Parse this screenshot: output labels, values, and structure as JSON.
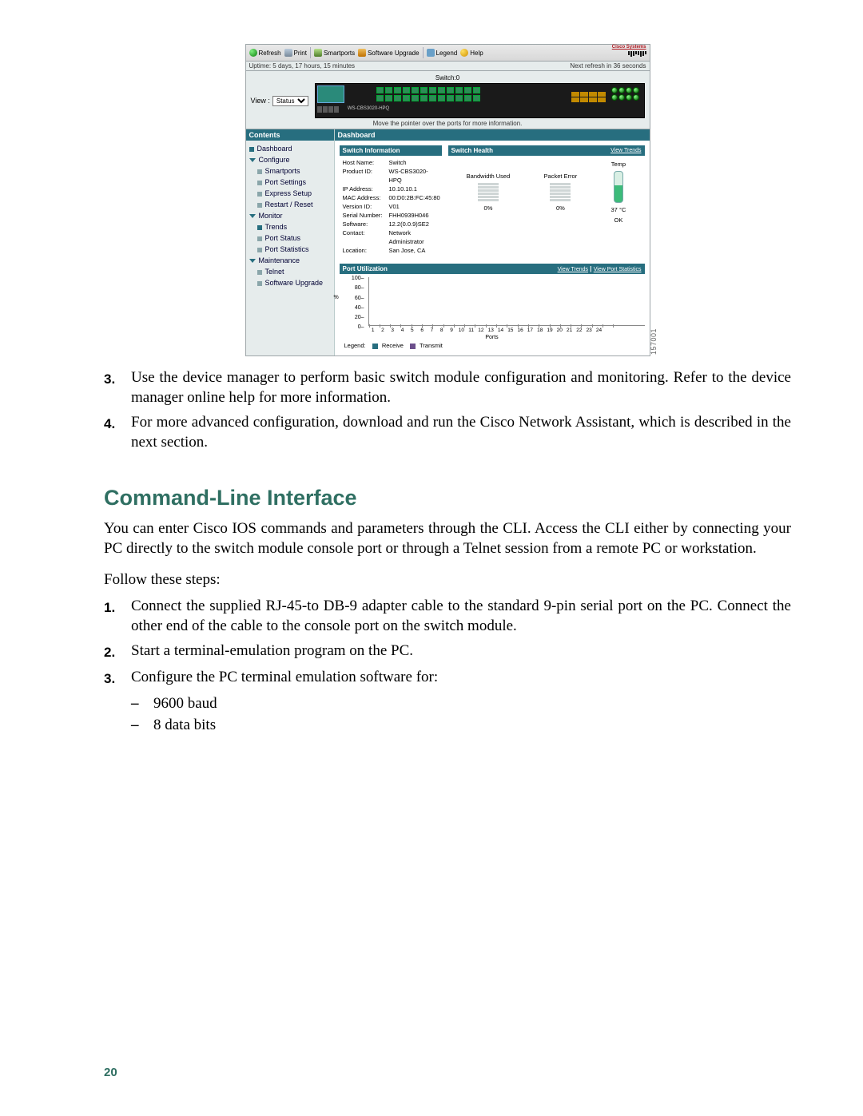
{
  "screenshot": {
    "toolbar": {
      "refresh": "Refresh",
      "print": "Print",
      "smartports": "Smartports",
      "software_upgrade": "Software Upgrade",
      "legend": "Legend",
      "help": "Help",
      "brand": "Cisco Systems"
    },
    "status_bar": {
      "uptime": "Uptime: 5 days, 17 hours, 15 minutes",
      "next_refresh": "Next refresh in 36 seconds"
    },
    "device": {
      "switch_label": "Switch:0",
      "view_label": "View :",
      "view_options": [
        "Status"
      ],
      "model_label": "WS-CBS3020-HPQ",
      "pointer_hint": "Move the pointer over the ports for more information."
    },
    "nav": {
      "header": "Contents",
      "items": [
        {
          "level": 0,
          "marker": "sq teal",
          "label": "Dashboard"
        },
        {
          "level": 0,
          "marker": "arrow",
          "label": "Configure"
        },
        {
          "level": 1,
          "marker": "sq grey",
          "label": "Smartports"
        },
        {
          "level": 1,
          "marker": "sq grey",
          "label": "Port Settings"
        },
        {
          "level": 1,
          "marker": "sq grey",
          "label": "Express Setup"
        },
        {
          "level": 1,
          "marker": "sq grey",
          "label": "Restart / Reset"
        },
        {
          "level": 0,
          "marker": "arrow",
          "label": "Monitor"
        },
        {
          "level": 1,
          "marker": "sq teal",
          "label": "Trends"
        },
        {
          "level": 1,
          "marker": "sq grey",
          "label": "Port Status"
        },
        {
          "level": 1,
          "marker": "sq grey",
          "label": "Port Statistics"
        },
        {
          "level": 0,
          "marker": "arrow",
          "label": "Maintenance"
        },
        {
          "level": 1,
          "marker": "sq grey",
          "label": "Telnet"
        },
        {
          "level": 1,
          "marker": "sq grey",
          "label": "Software Upgrade"
        }
      ]
    },
    "dashboard_header": "Dashboard",
    "switch_info": {
      "header": "Switch Information",
      "rows": [
        [
          "Host Name:",
          "Switch"
        ],
        [
          "Product ID:",
          "WS-CBS3020-HPQ"
        ],
        [
          "IP Address:",
          "10.10.10.1"
        ],
        [
          "MAC Address:",
          "00:D0:2B:FC:45:80"
        ],
        [
          "Version ID:",
          "V01"
        ],
        [
          "Serial Number:",
          "FHH0939H046"
        ],
        [
          "Software:",
          "12.2(0.0.9)SE2"
        ],
        [
          "Contact:",
          "Network Administrator"
        ],
        [
          "Location:",
          "San Jose, CA"
        ]
      ]
    },
    "switch_health": {
      "header": "Switch Health",
      "view_trends": "View Trends",
      "bandwidth_label": "Bandwidth Used",
      "bandwidth_value": "0%",
      "packet_error_label": "Packet Error",
      "packet_error_value": "0%",
      "temp_label": "Temp",
      "temp_value": "37 °C",
      "temp_status": "OK"
    },
    "port_util": {
      "header": "Port Utilization",
      "view_trends": "View Trends",
      "view_stats": "View Port Statistics",
      "ylabels": [
        "100",
        "80",
        "60",
        "40",
        "20",
        "0"
      ],
      "ypct": "%",
      "xtitle": "Ports",
      "legend_label": "Legend:",
      "legend_rx": "Receive",
      "legend_tx": "Transmit"
    },
    "side_number": "157001"
  },
  "chart_data": {
    "type": "bar",
    "title": "Port Utilization",
    "xlabel": "Ports",
    "ylabel": "%",
    "ylim": [
      0,
      100
    ],
    "categories": [
      "1",
      "2",
      "3",
      "4",
      "5",
      "6",
      "7",
      "8",
      "9",
      "10",
      "11",
      "12",
      "13",
      "14",
      "15",
      "16",
      "17",
      "18",
      "19",
      "20",
      "21",
      "22",
      "23",
      "24"
    ],
    "series": [
      {
        "name": "Receive",
        "values": [
          0,
          0,
          0,
          0,
          0,
          0,
          0,
          0,
          0,
          0,
          0,
          0,
          0,
          0,
          0,
          0,
          0,
          0,
          0,
          0,
          0,
          0,
          0,
          0
        ]
      },
      {
        "name": "Transmit",
        "values": [
          0,
          0,
          0,
          0,
          0,
          0,
          0,
          0,
          0,
          0,
          0,
          0,
          0,
          0,
          0,
          0,
          0,
          0,
          0,
          0,
          0,
          0,
          0,
          0
        ]
      }
    ]
  },
  "doc": {
    "item3_num": "3.",
    "item3_text": "Use the device manager to perform basic switch module configuration and monitoring. Refer to the device manager online help for more information.",
    "item4_num": "4.",
    "item4_text": "For more advanced configuration, download and run the Cisco Network Assistant, which is described in the next section.",
    "cli_heading": "Command-Line Interface",
    "cli_para": "You can enter Cisco IOS commands and parameters through the CLI. Access the CLI either by connecting your PC directly to the switch module console port or through a Telnet session from a remote PC or workstation.",
    "follow": "Follow these steps:",
    "step1_num": "1.",
    "step1_text": "Connect the supplied RJ-45-to DB-9 adapter cable to the standard 9-pin serial port on the PC. Connect the other end of the cable to the console port on the switch module.",
    "step2_num": "2.",
    "step2_text": "Start a terminal-emulation program on the PC.",
    "step3_num": "3.",
    "step3_text": "Configure the PC terminal emulation software for:",
    "sub1": "9600 baud",
    "sub2": "8 data bits",
    "page_no": "20"
  }
}
